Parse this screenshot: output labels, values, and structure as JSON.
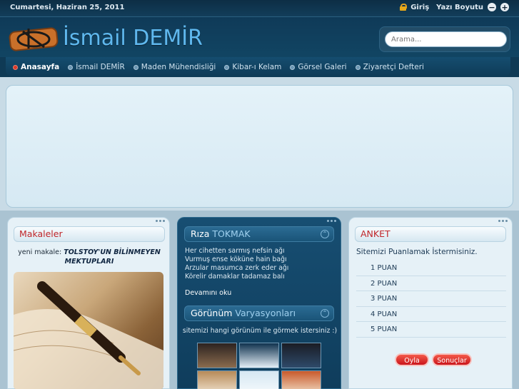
{
  "topbar": {
    "date": "Cumartesi, Haziran 25, 2011",
    "login_label": "Giriş",
    "font_size_label": "Yazı Boyutu",
    "decrease_label": "−",
    "increase_label": "+"
  },
  "header": {
    "site_name": "İsmail DEMİR",
    "search_placeholder": "Arama..."
  },
  "nav": {
    "items": [
      {
        "label": "Anasayfa"
      },
      {
        "label": "İsmail DEMİR"
      },
      {
        "label": "Maden Mühendisliği"
      },
      {
        "label": "Kibar-ı Kelam"
      },
      {
        "label": "Görsel Galeri"
      },
      {
        "label": "Ziyaretçi Defteri"
      }
    ]
  },
  "articles": {
    "title": "Makaleler",
    "new_prefix": "yeni makale:",
    "new_title": "TOLSTOY'UN BİLİNMEYEN MEKTUPLARI"
  },
  "poem_panel": {
    "title_first": "Rıza",
    "title_second": "TOKMAK",
    "lines": [
      "Her cihetten sarmış nefsin ağı",
      "Vurmuş ense köküne hain bağı",
      "Arzular masumca zerk eder ağı",
      "Körelir damaklar tadamaz balı"
    ],
    "more_label": "Devamını oku"
  },
  "variants_panel": {
    "title_first": "Görünüm",
    "title_second": "Varyasyonları",
    "text": "sitemizi hangi görünüm ile görmek istersiniz :)"
  },
  "poll": {
    "title": "ANKET",
    "question": "Sitemizi Puanlamak İstermisiniz.",
    "options": [
      "1 PUAN",
      "2 PUAN",
      "3 PUAN",
      "4 PUAN",
      "5 PUAN"
    ],
    "vote_label": "Oyla",
    "results_label": "Sonuçlar"
  },
  "colors": {
    "accent_red": "#c0262a",
    "site_name_blue": "#5fb8ee",
    "navy": "#0f3a55"
  }
}
